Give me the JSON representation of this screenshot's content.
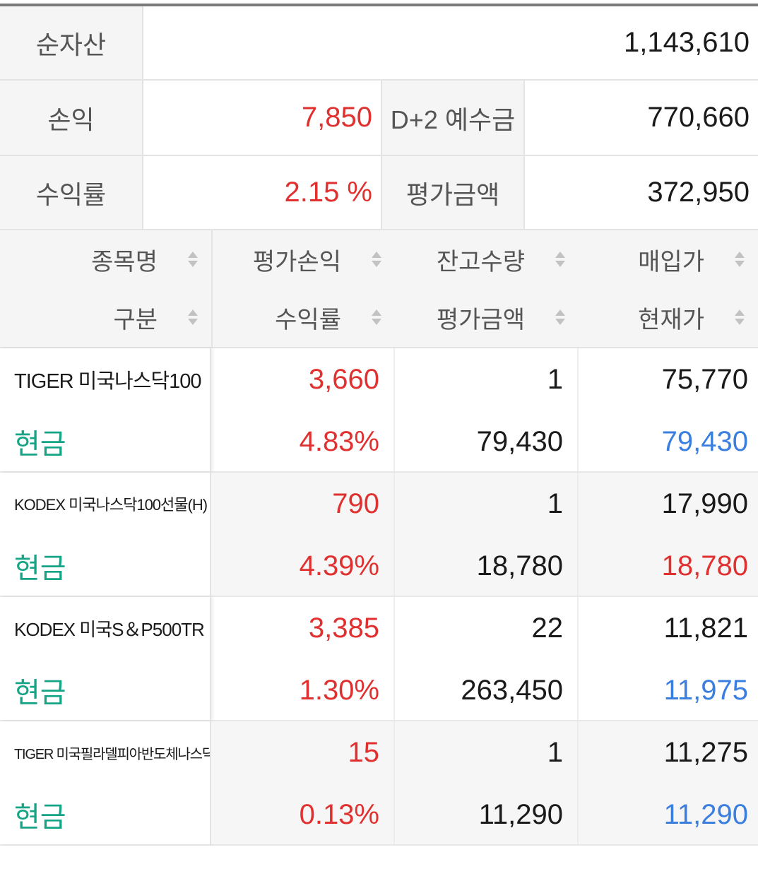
{
  "summary": {
    "net_assets_label": "순자산",
    "net_assets_value": "1,143,610",
    "pnl_label": "손익",
    "pnl_value": "7,850",
    "deposit_label": "D+2 예수금",
    "deposit_value": "770,660",
    "return_label": "수익률",
    "return_value": "2.15 %",
    "eval_label": "평가금액",
    "eval_value": "372,950"
  },
  "table_header": {
    "col1": {
      "top": "종목명",
      "bottom": "구분"
    },
    "col2": {
      "top": "평가손익",
      "bottom": "수익률"
    },
    "col3": {
      "top": "잔고수량",
      "bottom": "평가금액"
    },
    "col4": {
      "top": "매입가",
      "bottom": "현재가"
    }
  },
  "holdings": [
    {
      "name": "TIGER 미국나스닥100",
      "type": "현금",
      "pnl": "3,660",
      "return": "4.83%",
      "quantity": "1",
      "eval_amount": "79,430",
      "buy_price": "75,770",
      "current_price": "79,430",
      "current_price_color": "#3a7fe0"
    },
    {
      "name": "KODEX 미국나스닥100선물(H)",
      "type": "현금",
      "pnl": "790",
      "return": "4.39%",
      "quantity": "1",
      "eval_amount": "18,780",
      "buy_price": "17,990",
      "current_price": "18,780",
      "current_price_color": "#e0302f"
    },
    {
      "name": "KODEX 미국S＆P500TR",
      "type": "현금",
      "pnl": "3,385",
      "return": "1.30%",
      "quantity": "22",
      "eval_amount": "263,450",
      "buy_price": "11,821",
      "current_price": "11,975",
      "current_price_color": "#3a7fe0"
    },
    {
      "name": "TIGER 미국필라델피아반도체나스닥",
      "type": "현금",
      "pnl": "15",
      "return": "0.13%",
      "quantity": "1",
      "eval_amount": "11,290",
      "buy_price": "11,275",
      "current_price": "11,290",
      "current_price_color": "#3a7fe0"
    }
  ],
  "colors": {
    "positive": "#e0302f",
    "blue_price": "#3a7fe0",
    "cash_type": "#15a586",
    "label_bg": "#f5f5f5"
  },
  "icons": {
    "sort": "sort-updown-icon"
  }
}
